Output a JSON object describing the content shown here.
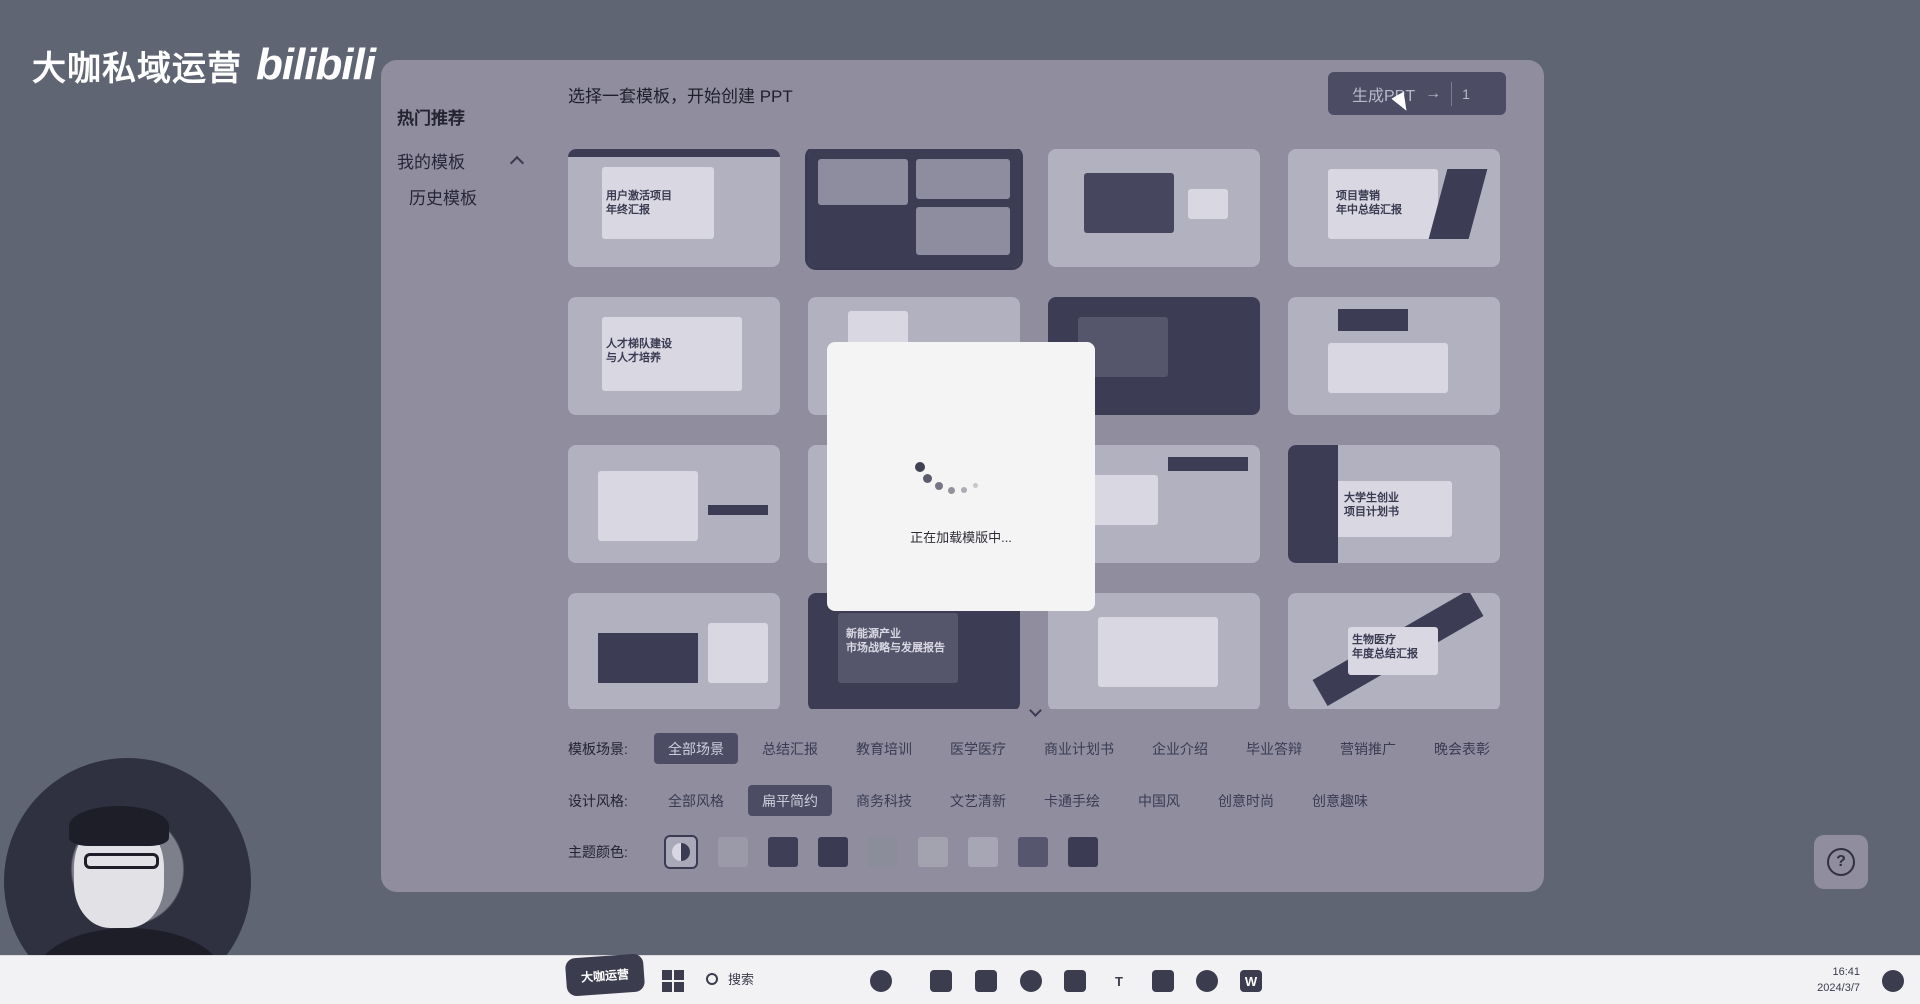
{
  "watermark": {
    "channel": "大咖私域运营",
    "logo": "bilibili"
  },
  "sidebar": {
    "header": "热门推荐",
    "items": [
      {
        "label": "我的模板"
      },
      {
        "label": "历史模板"
      }
    ]
  },
  "main": {
    "title": "选择一套模板，开始创建 PPT",
    "generate": {
      "label": "生成PPT",
      "arrow": "→",
      "count": "1"
    }
  },
  "templates": [
    {
      "caption": "用户激活项目\n年终汇报"
    },
    {
      "caption": ""
    },
    {
      "caption": ""
    },
    {
      "caption": "项目营销\n年中总结汇报"
    },
    {
      "caption": "人才梯队建设\n与人才培养"
    },
    {
      "caption": ""
    },
    {
      "caption": ""
    },
    {
      "caption": ""
    },
    {
      "caption": ""
    },
    {
      "caption": ""
    },
    {
      "caption": ""
    },
    {
      "caption": "大学生创业\n项目计划书"
    },
    {
      "caption": ""
    },
    {
      "caption": "新能源产业\n市场战略与发展报告"
    },
    {
      "caption": ""
    },
    {
      "caption": "生物医疗\n年度总结汇报"
    }
  ],
  "filters": {
    "scene_label": "模板场景:",
    "scenes": [
      "全部场景",
      "总结汇报",
      "教育培训",
      "医学医疗",
      "商业计划书",
      "企业介绍",
      "毕业答辩",
      "营销推广",
      "晚会表彰"
    ],
    "scene_active": "全部场景",
    "style_label": "设计风格:",
    "styles": [
      "全部风格",
      "扁平简约",
      "商务科技",
      "文艺清新",
      "卡通手绘",
      "中国风",
      "创意时尚",
      "创意趣味"
    ],
    "style_active": "扁平简约",
    "color_label": "主题颜色:",
    "colors": [
      "#a9a8b8",
      "#9a9aa8",
      "#3e3f57",
      "#3a3b52",
      "#8c8d9a",
      "#a3a3b0",
      "#a7a6b4",
      "#56576e",
      "#3b3c54"
    ]
  },
  "modal": {
    "text": "正在加载模版中..."
  },
  "help": {
    "icon": "?"
  },
  "taskbar": {
    "sticker": "大咖运营",
    "search": "搜索",
    "time": "16:41",
    "date": "2024/3/7"
  }
}
